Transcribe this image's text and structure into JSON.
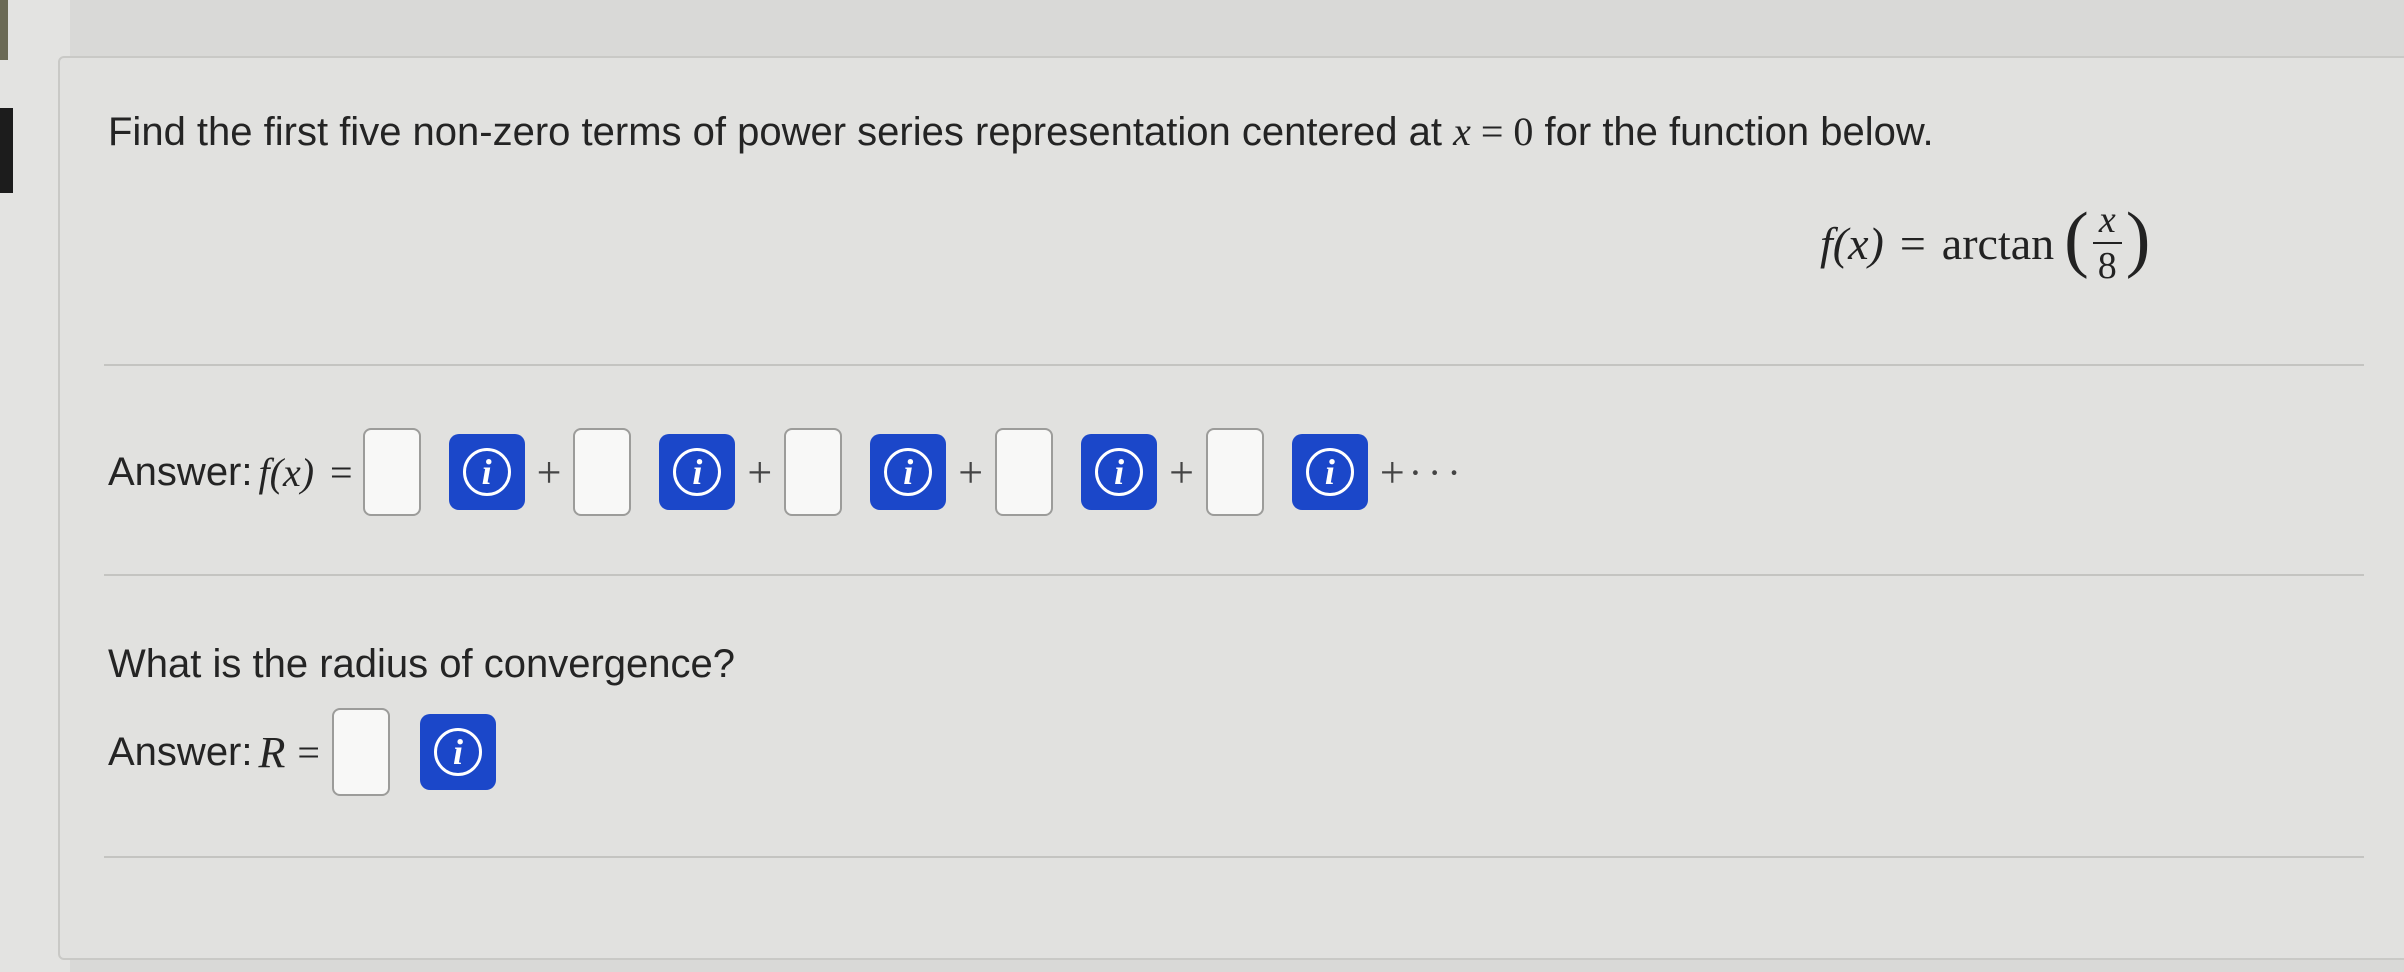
{
  "question": {
    "prefix": "Find the first five non-zero terms of power series representation centered at ",
    "var": "x",
    "eq": " = 0",
    "suffix": " for the function below."
  },
  "function": {
    "lhs_f": "f",
    "lhs_x": "(x)",
    "eq": "=",
    "fn": "arctan",
    "num": "x",
    "den": "8"
  },
  "series_answer": {
    "label": "Answer: ",
    "f": "f",
    "fx": "(x)",
    "eq": "=",
    "plus": "+",
    "ellipsis": "···",
    "info_glyph": "i",
    "term_count": 5
  },
  "radius": {
    "question": "What is the radius of convergence?",
    "label": "Answer: ",
    "var": "R",
    "eq": "=",
    "info_glyph": "i"
  },
  "colors": {
    "info_button": "#1b47c9",
    "card_bg": "#e1e1df"
  },
  "icons": {
    "info": "info-circle-icon"
  }
}
